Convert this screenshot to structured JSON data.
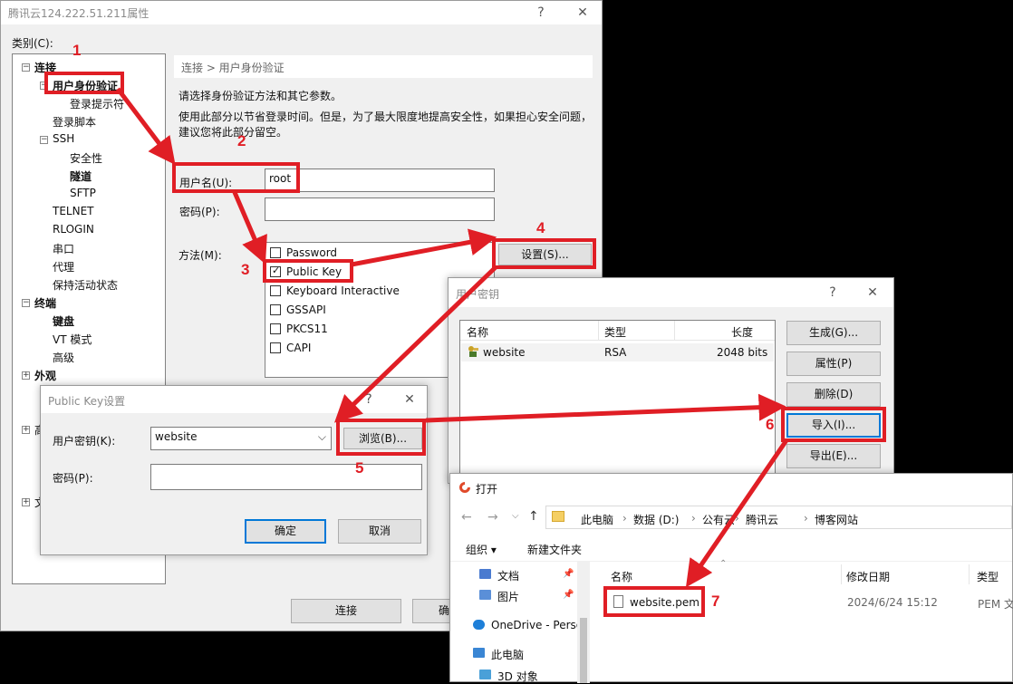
{
  "main_window": {
    "title": "腾讯云124.222.51.211属性",
    "help": "?",
    "close": "✕",
    "category_label": "类别(C):",
    "tree": [
      {
        "label": "连接",
        "bold": true
      },
      {
        "label": "用户身份验证",
        "bold": true
      },
      {
        "label": "登录提示符"
      },
      {
        "label": "登录脚本"
      },
      {
        "label": "SSH"
      },
      {
        "label": "安全性"
      },
      {
        "label": "隧道",
        "bold": true
      },
      {
        "label": "SFTP"
      },
      {
        "label": "TELNET"
      },
      {
        "label": "RLOGIN"
      },
      {
        "label": "串口"
      },
      {
        "label": "代理"
      },
      {
        "label": "保持活动状态"
      },
      {
        "label": "终端",
        "bold": true
      },
      {
        "label": "键盘",
        "bold": true
      },
      {
        "label": "VT 模式"
      },
      {
        "label": "高级"
      },
      {
        "label": "外观",
        "bold": true
      },
      {
        "label": "高"
      },
      {
        "label": "文"
      }
    ],
    "breadcrumb": "连接 > 用户身份验证",
    "intro": "请选择身份验证方法和其它参数。",
    "desc_line1": "使用此部分以节省登录时间。但是，为了最大限度地提高安全性，如果担心安全问题，",
    "desc_line2": "建议您将此部分留空。",
    "username_label": "用户名(U):",
    "username_value": "root",
    "password_label": "密码(P):",
    "method_label": "方法(M):",
    "methods": [
      {
        "label": "Password",
        "checked": false
      },
      {
        "label": "Public Key",
        "checked": true
      },
      {
        "label": "Keyboard Interactive",
        "checked": false
      },
      {
        "label": "GSSAPI",
        "checked": false
      },
      {
        "label": "PKCS11",
        "checked": false
      },
      {
        "label": "CAPI",
        "checked": false
      }
    ],
    "settings_button": "设置(S)...",
    "connect_button": "连接",
    "cancel_partial": "确"
  },
  "pubkey_dialog": {
    "title": "Public Key设置",
    "help": "?",
    "close": "✕",
    "user_key_label": "用户密钥(K):",
    "user_key_value": "website",
    "browse_button": "浏览(B)...",
    "password_label": "密码(P):",
    "ok_button": "确定",
    "cancel_button": "取消"
  },
  "userkey_dialog": {
    "title": "用户密钥",
    "help": "?",
    "close": "✕",
    "columns": [
      "名称",
      "类型",
      "长度"
    ],
    "rows": [
      {
        "name": "website",
        "type": "RSA",
        "length": "2048 bits"
      }
    ],
    "buttons": [
      "生成(G)...",
      "属性(P)",
      "删除(D)",
      "导入(I)...",
      "导出(E)..."
    ]
  },
  "open_dialog": {
    "title": "打开",
    "path": [
      "此电脑",
      "数据 (D:)",
      "公有云",
      "腾讯云",
      "博客网站"
    ],
    "organize": "组织 ▾",
    "new_folder": "新建文件夹",
    "nav": [
      {
        "label": "文档",
        "icon": "document-icon"
      },
      {
        "label": "图片",
        "icon": "picture-icon"
      },
      {
        "label": "OneDrive - Perso",
        "icon": "cloud-icon"
      },
      {
        "label": "此电脑",
        "icon": "computer-icon"
      },
      {
        "label": "3D 对象",
        "icon": "cube-icon"
      }
    ],
    "columns": [
      "名称",
      "修改日期",
      "类型"
    ],
    "file": {
      "name": "website.pem",
      "date": "2024/6/24 15:12",
      "type": "PEM 文"
    }
  },
  "annotations": [
    "1",
    "2",
    "3",
    "4",
    "5",
    "6",
    "7"
  ],
  "colors": {
    "accent_red": "#e01e25",
    "selection_blue": "#0078d7"
  }
}
